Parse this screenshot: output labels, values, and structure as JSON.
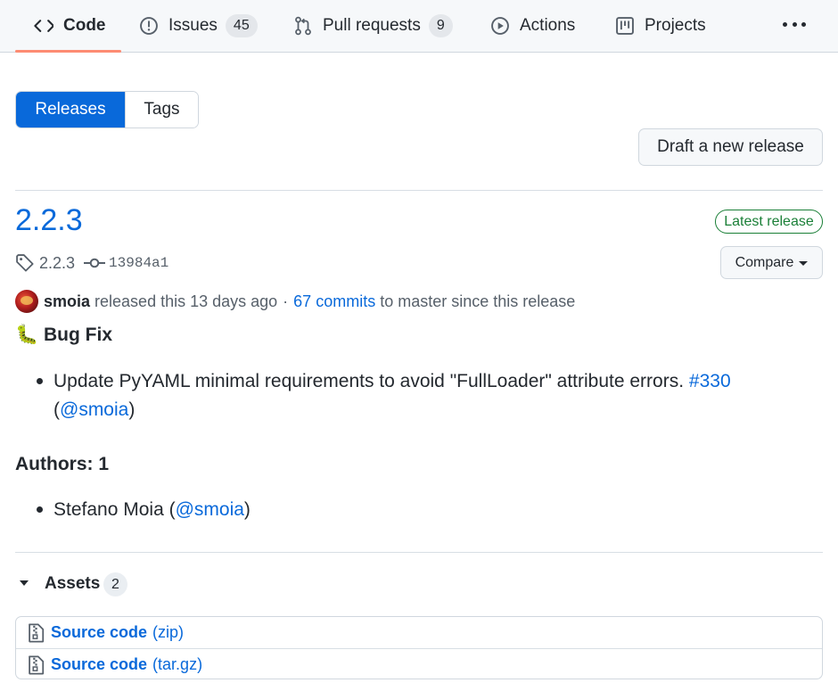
{
  "nav": {
    "tabs": [
      {
        "label": "Code",
        "icon": "code-icon"
      },
      {
        "label": "Issues",
        "count": "45",
        "icon": "issue-icon"
      },
      {
        "label": "Pull requests",
        "count": "9",
        "icon": "pull-request-icon"
      },
      {
        "label": "Actions",
        "icon": "play-icon"
      },
      {
        "label": "Projects",
        "icon": "project-icon"
      }
    ],
    "more_icon": "kebab-horizontal-icon"
  },
  "segmented": {
    "releases": "Releases",
    "tags": "Tags"
  },
  "draft_button": "Draft a new release",
  "release": {
    "title": "2.2.3",
    "badge": "Latest release",
    "tag": "2.2.3",
    "commit": "13984a1",
    "compare_label": "Compare",
    "author": "smoia",
    "released_text": "released this 13 days ago",
    "sep": "·",
    "commits_link": "67 commits",
    "since_text": "to master since this release"
  },
  "notes": {
    "bugfix_emoji": "🐛",
    "bugfix_heading": "Bug Fix",
    "bugfix_item_text": "Update PyYAML minimal requirements to avoid \"FullLoader\" attribute errors.",
    "bugfix_item_issue": "#330",
    "bugfix_item_open": "(",
    "bugfix_item_user": "@smoia",
    "bugfix_item_close": ")",
    "authors_heading": "Authors: 1",
    "author_name": "Stefano Moia (",
    "author_user": "@smoia",
    "author_close": ")"
  },
  "assets": {
    "label": "Assets",
    "count": "2",
    "items": [
      {
        "name": "Source code",
        "ext": "(zip)"
      },
      {
        "name": "Source code",
        "ext": "(tar.gz)"
      }
    ]
  },
  "colors": {
    "accent": "#0969da",
    "success": "#1a7f37",
    "tab_underline": "#fd8c73"
  }
}
